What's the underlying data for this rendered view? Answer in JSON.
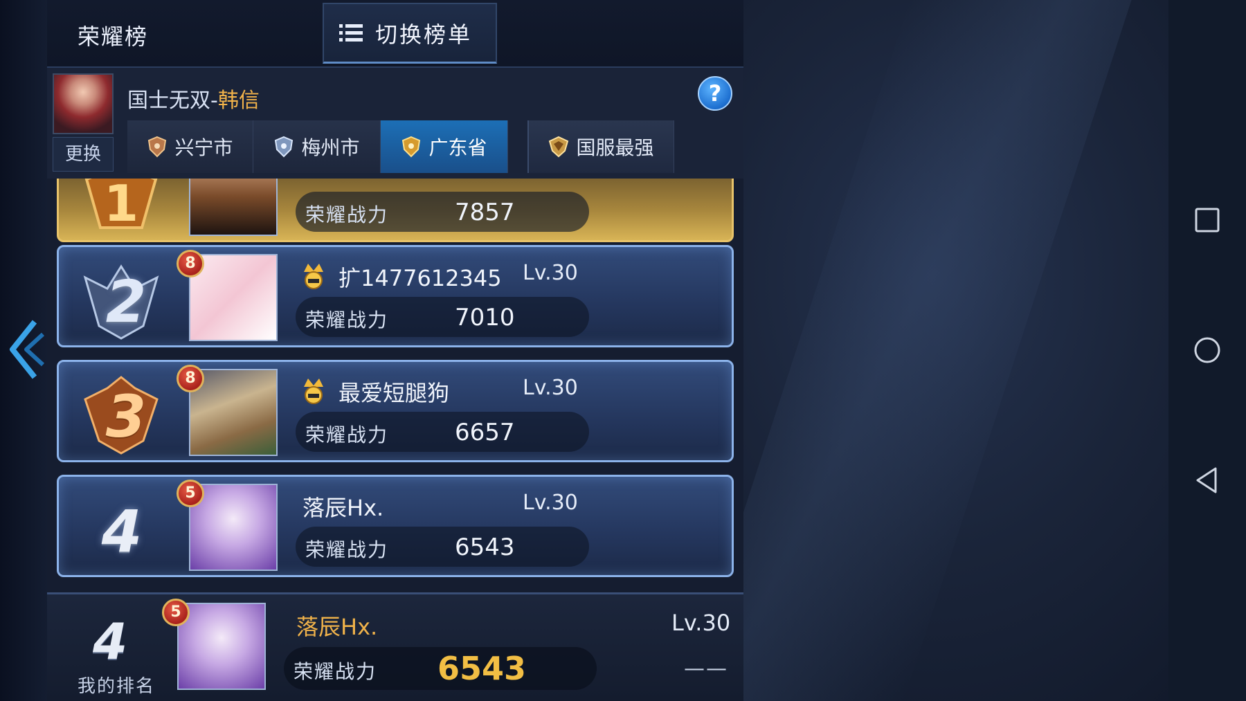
{
  "header": {
    "title": "荣耀榜",
    "switch_label": "切换榜单",
    "switch_icon": "list-icon"
  },
  "hero": {
    "name_prefix": "国士无双-",
    "name_highlight": "韩信",
    "change_label": "更换",
    "help_symbol": "?"
  },
  "tabs": [
    {
      "label": "兴宁市",
      "active": false
    },
    {
      "label": "梅州市",
      "active": false
    },
    {
      "label": "广东省",
      "active": true
    },
    {
      "label": "国服最强",
      "active": false
    }
  ],
  "power_label": "荣耀战力",
  "entries": [
    {
      "rank": "1",
      "name": "",
      "level": "",
      "power": "7857"
    },
    {
      "rank": "2",
      "name": "扩1477612345",
      "level": "Lv.30",
      "power": "7010",
      "badge": "8"
    },
    {
      "rank": "3",
      "name": "最爱短腿狗",
      "level": "Lv.30",
      "power": "6657",
      "badge": "8"
    },
    {
      "rank": "4",
      "name": "落辰Hx.",
      "level": "Lv.30",
      "power": "6543",
      "badge": "5"
    }
  ],
  "mine": {
    "rank": "4",
    "rank_label": "我的排名",
    "name": "落辰Hx.",
    "level": "Lv.30",
    "power_label": "荣耀战力",
    "power": "6543",
    "badge": "5",
    "trend": "——"
  },
  "colors": {
    "accent": "#f2b34a",
    "active_tab": "#1c6fb6",
    "card_border": "#8cb3ea",
    "gold_card": "#d8b456"
  },
  "system_nav": [
    "recent-apps-icon",
    "home-icon",
    "back-icon"
  ]
}
